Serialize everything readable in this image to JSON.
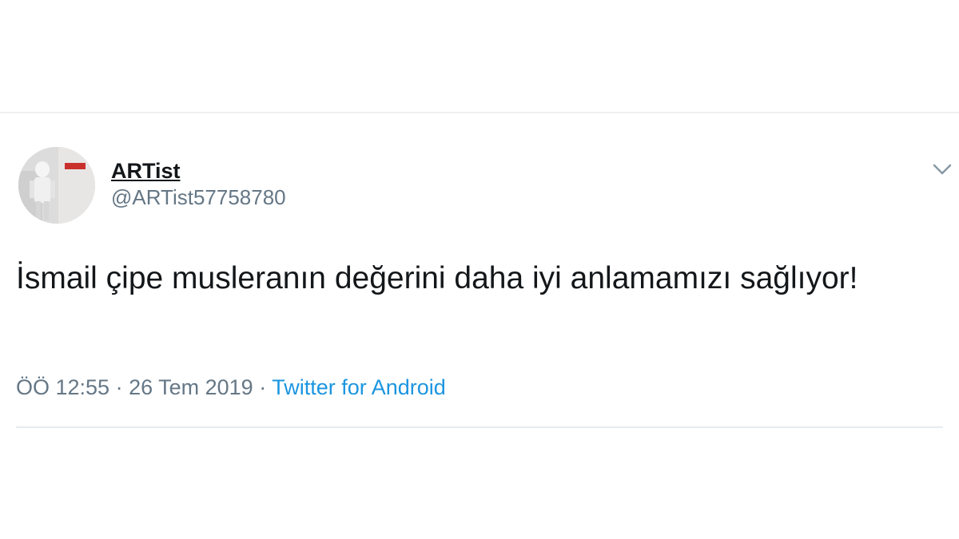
{
  "tweet": {
    "author": {
      "display_name": "ARTist",
      "handle": "@ARTist57758780",
      "avatar_icon": "profile-photo-avatar"
    },
    "menu_icon": "chevron-down-icon",
    "text": "İsmail çipe musleranın değerini daha iyi anlamamızı sağlıyor!",
    "meta": {
      "time": "ÖÖ 12:55",
      "separator": " · ",
      "date": "26 Tem 2019",
      "source": "Twitter for Android"
    }
  },
  "colors": {
    "text_primary": "#14171a",
    "text_secondary": "#657786",
    "link": "#1b95e0",
    "divider": "#e6ecf0"
  }
}
